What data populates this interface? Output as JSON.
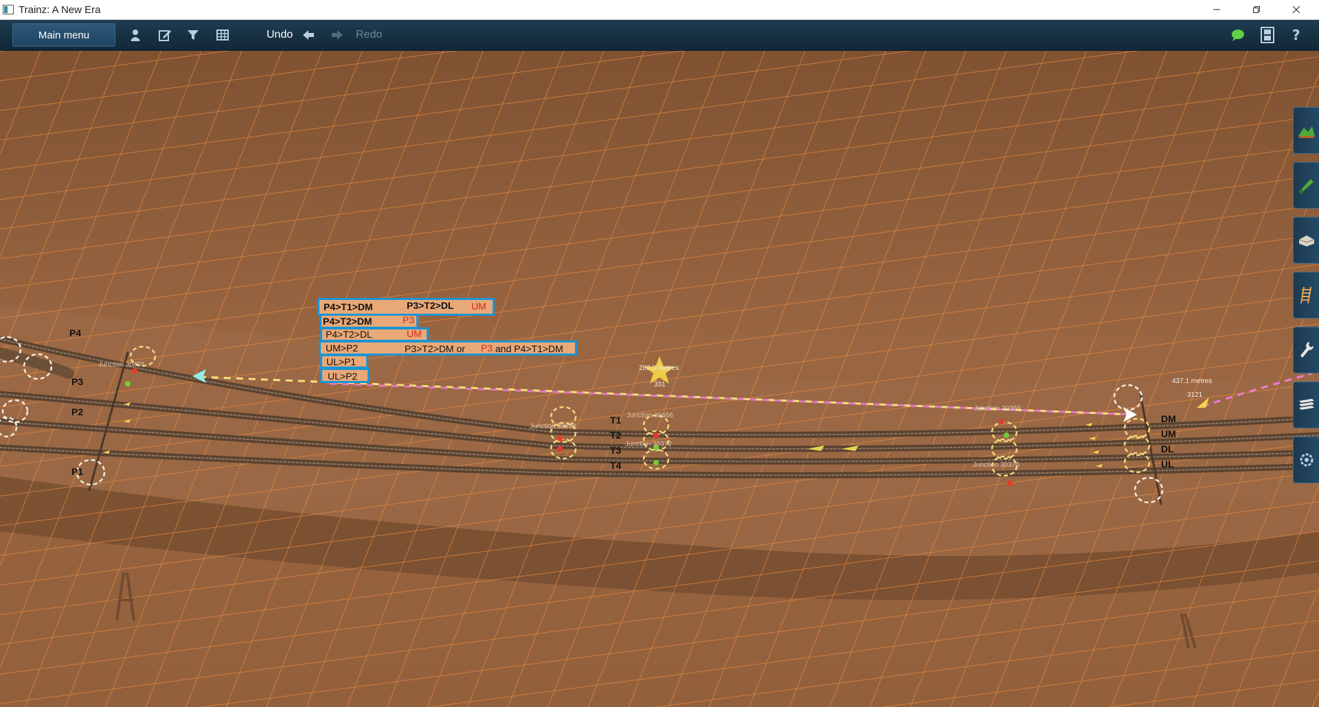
{
  "window": {
    "title": "Trainz: A New Era"
  },
  "toolbar": {
    "main_menu": "Main menu",
    "undo": "Undo",
    "redo": "Redo"
  },
  "annotations": {
    "row1_left": "P4>T1>DM",
    "row1_right": "P3>T2>DL",
    "row1_red": "UM",
    "row2_left": "P4>T2>DM",
    "row2_red": "P3",
    "row3_left": "P4>T2>DL",
    "row3_red": "UM",
    "row4_left": "UM>P2",
    "row4_mid1": "P3>T2>DM or",
    "row4_red": "P3",
    "row4_mid2": "and P4>T1>DM",
    "row5": "UL>P1",
    "row6": "UL>P2"
  },
  "tracks": {
    "left": [
      "P4",
      "P3",
      "P2",
      "P1"
    ],
    "middle": [
      "T1",
      "T2",
      "T3",
      "T4"
    ],
    "right": [
      "DM",
      "UM",
      "DL",
      "UL"
    ]
  },
  "junctions": {
    "j_left": "Junction 30401",
    "j_mid_a": "Junction 30398",
    "j_mid_b": "Junction 30466",
    "j_mid_c": "Junction 30372",
    "j_right_a": "Junction 30369",
    "j_right_b": "Junction 30370"
  },
  "markers": {
    "m1_dist": "280.0 metres",
    "m1_num": "331",
    "m2_dist": "437.1 metres",
    "m2_num": "3121"
  },
  "colors": {
    "toolbar": "#16303f",
    "terrain": "#8a5a38",
    "grid": "#f08c3c",
    "annotation_border": "#1b95d6",
    "annotation_red": "#d42a1a"
  }
}
